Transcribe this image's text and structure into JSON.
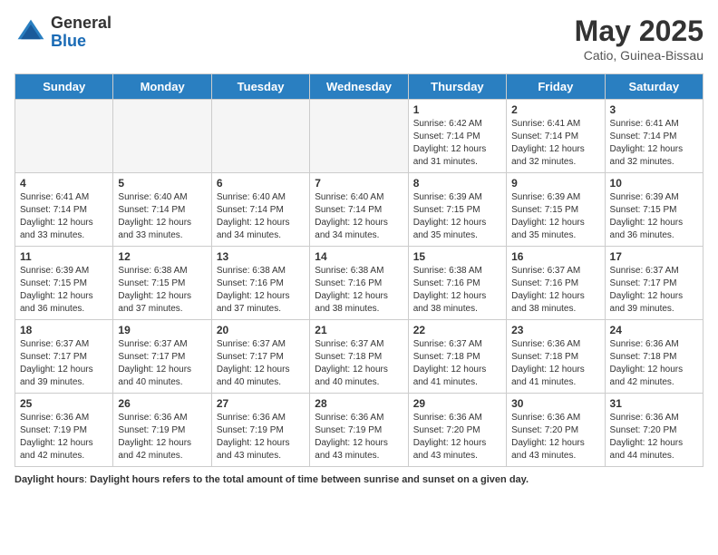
{
  "header": {
    "logo_general": "General",
    "logo_blue": "Blue",
    "month_title": "May 2025",
    "location": "Catio, Guinea-Bissau"
  },
  "days_of_week": [
    "Sunday",
    "Monday",
    "Tuesday",
    "Wednesday",
    "Thursday",
    "Friday",
    "Saturday"
  ],
  "weeks": [
    [
      {
        "day": "",
        "info": ""
      },
      {
        "day": "",
        "info": ""
      },
      {
        "day": "",
        "info": ""
      },
      {
        "day": "",
        "info": ""
      },
      {
        "day": "1",
        "info": "Sunrise: 6:42 AM\nSunset: 7:14 PM\nDaylight: 12 hours\nand 31 minutes."
      },
      {
        "day": "2",
        "info": "Sunrise: 6:41 AM\nSunset: 7:14 PM\nDaylight: 12 hours\nand 32 minutes."
      },
      {
        "day": "3",
        "info": "Sunrise: 6:41 AM\nSunset: 7:14 PM\nDaylight: 12 hours\nand 32 minutes."
      }
    ],
    [
      {
        "day": "4",
        "info": "Sunrise: 6:41 AM\nSunset: 7:14 PM\nDaylight: 12 hours\nand 33 minutes."
      },
      {
        "day": "5",
        "info": "Sunrise: 6:40 AM\nSunset: 7:14 PM\nDaylight: 12 hours\nand 33 minutes."
      },
      {
        "day": "6",
        "info": "Sunrise: 6:40 AM\nSunset: 7:14 PM\nDaylight: 12 hours\nand 34 minutes."
      },
      {
        "day": "7",
        "info": "Sunrise: 6:40 AM\nSunset: 7:14 PM\nDaylight: 12 hours\nand 34 minutes."
      },
      {
        "day": "8",
        "info": "Sunrise: 6:39 AM\nSunset: 7:15 PM\nDaylight: 12 hours\nand 35 minutes."
      },
      {
        "day": "9",
        "info": "Sunrise: 6:39 AM\nSunset: 7:15 PM\nDaylight: 12 hours\nand 35 minutes."
      },
      {
        "day": "10",
        "info": "Sunrise: 6:39 AM\nSunset: 7:15 PM\nDaylight: 12 hours\nand 36 minutes."
      }
    ],
    [
      {
        "day": "11",
        "info": "Sunrise: 6:39 AM\nSunset: 7:15 PM\nDaylight: 12 hours\nand 36 minutes."
      },
      {
        "day": "12",
        "info": "Sunrise: 6:38 AM\nSunset: 7:15 PM\nDaylight: 12 hours\nand 37 minutes."
      },
      {
        "day": "13",
        "info": "Sunrise: 6:38 AM\nSunset: 7:16 PM\nDaylight: 12 hours\nand 37 minutes."
      },
      {
        "day": "14",
        "info": "Sunrise: 6:38 AM\nSunset: 7:16 PM\nDaylight: 12 hours\nand 38 minutes."
      },
      {
        "day": "15",
        "info": "Sunrise: 6:38 AM\nSunset: 7:16 PM\nDaylight: 12 hours\nand 38 minutes."
      },
      {
        "day": "16",
        "info": "Sunrise: 6:37 AM\nSunset: 7:16 PM\nDaylight: 12 hours\nand 38 minutes."
      },
      {
        "day": "17",
        "info": "Sunrise: 6:37 AM\nSunset: 7:17 PM\nDaylight: 12 hours\nand 39 minutes."
      }
    ],
    [
      {
        "day": "18",
        "info": "Sunrise: 6:37 AM\nSunset: 7:17 PM\nDaylight: 12 hours\nand 39 minutes."
      },
      {
        "day": "19",
        "info": "Sunrise: 6:37 AM\nSunset: 7:17 PM\nDaylight: 12 hours\nand 40 minutes."
      },
      {
        "day": "20",
        "info": "Sunrise: 6:37 AM\nSunset: 7:17 PM\nDaylight: 12 hours\nand 40 minutes."
      },
      {
        "day": "21",
        "info": "Sunrise: 6:37 AM\nSunset: 7:18 PM\nDaylight: 12 hours\nand 40 minutes."
      },
      {
        "day": "22",
        "info": "Sunrise: 6:37 AM\nSunset: 7:18 PM\nDaylight: 12 hours\nand 41 minutes."
      },
      {
        "day": "23",
        "info": "Sunrise: 6:36 AM\nSunset: 7:18 PM\nDaylight: 12 hours\nand 41 minutes."
      },
      {
        "day": "24",
        "info": "Sunrise: 6:36 AM\nSunset: 7:18 PM\nDaylight: 12 hours\nand 42 minutes."
      }
    ],
    [
      {
        "day": "25",
        "info": "Sunrise: 6:36 AM\nSunset: 7:19 PM\nDaylight: 12 hours\nand 42 minutes."
      },
      {
        "day": "26",
        "info": "Sunrise: 6:36 AM\nSunset: 7:19 PM\nDaylight: 12 hours\nand 42 minutes."
      },
      {
        "day": "27",
        "info": "Sunrise: 6:36 AM\nSunset: 7:19 PM\nDaylight: 12 hours\nand 43 minutes."
      },
      {
        "day": "28",
        "info": "Sunrise: 6:36 AM\nSunset: 7:19 PM\nDaylight: 12 hours\nand 43 minutes."
      },
      {
        "day": "29",
        "info": "Sunrise: 6:36 AM\nSunset: 7:20 PM\nDaylight: 12 hours\nand 43 minutes."
      },
      {
        "day": "30",
        "info": "Sunrise: 6:36 AM\nSunset: 7:20 PM\nDaylight: 12 hours\nand 43 minutes."
      },
      {
        "day": "31",
        "info": "Sunrise: 6:36 AM\nSunset: 7:20 PM\nDaylight: 12 hours\nand 44 minutes."
      }
    ]
  ],
  "footer": {
    "label": "Daylight hours",
    "description": "Daylight hours refers to the total amount of time between sunrise and sunset on a given day."
  }
}
